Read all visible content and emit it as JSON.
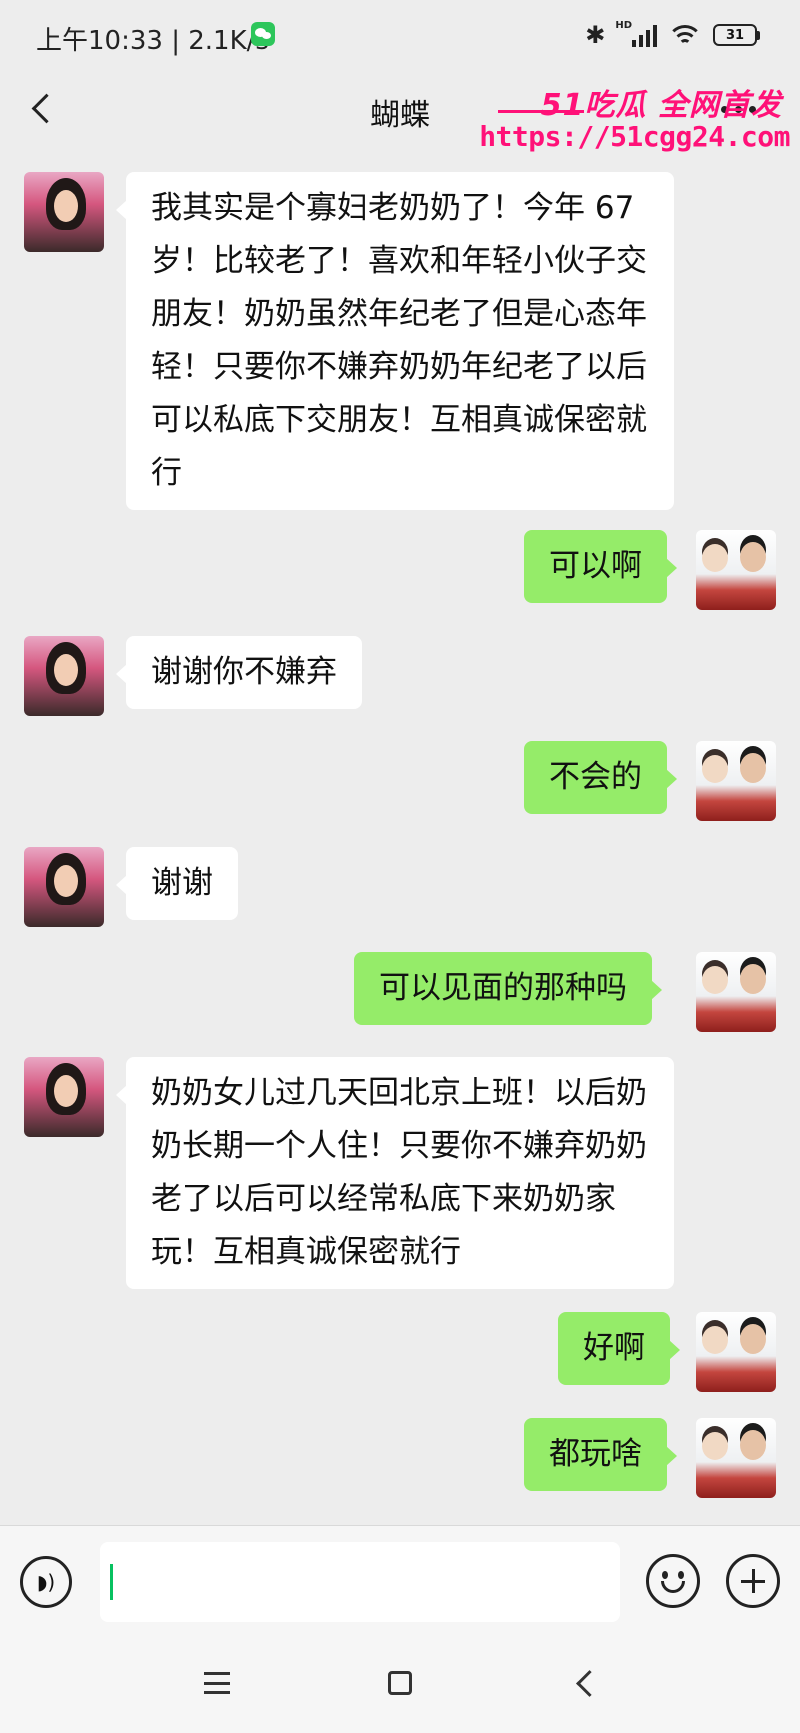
{
  "status_bar": {
    "time_speed": "上午10:33 | 2.1K/s",
    "hd_label": "HD",
    "bluetooth_symbol": "✱",
    "battery_level": "31"
  },
  "header": {
    "title": "蝴蝶"
  },
  "watermark": {
    "brand": "51吃瓜 全网首发",
    "url": "https://51cgg24.com"
  },
  "messages": [
    {
      "side": "in",
      "text": "我其实是个寡妇老奶奶了！今年 67 岁！比较老了！喜欢和年轻小伙子交朋友！奶奶虽然年纪老了但是心态年轻！只要你不嫌弃奶奶年纪老了以后可以私底下交朋友！互相真诚保密就行"
    },
    {
      "side": "out",
      "text": "可以啊"
    },
    {
      "side": "in",
      "text": "谢谢你不嫌弃"
    },
    {
      "side": "out",
      "text": "不会的"
    },
    {
      "side": "in",
      "text": "谢谢"
    },
    {
      "side": "out",
      "text": "可以见面的那种吗"
    },
    {
      "side": "in",
      "text": "奶奶女儿过几天回北京上班！以后奶奶长期一个人住！只要你不嫌弃奶奶老了以后可以经常私底下来奶奶家玩！互相真诚保密就行"
    },
    {
      "side": "out",
      "text": "好啊"
    },
    {
      "side": "out",
      "text": "都玩啥"
    }
  ],
  "input": {
    "value": "",
    "voice_symbol": "◗)"
  },
  "colors": {
    "incoming_bubble": "#ffffff",
    "outgoing_bubble": "#95ec69",
    "background": "#ededed",
    "watermark": "#ff1178"
  }
}
